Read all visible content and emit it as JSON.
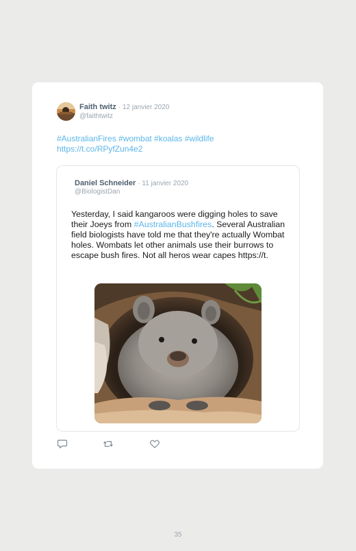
{
  "tweet": {
    "author_name": "Faith twitz",
    "date": "· 12 janvier 2020",
    "handle": "@faithtwitz",
    "hashtags": "#AustralianFires #wombat #koalas #wildlife",
    "link": "https://t.co/RPyfZun4e2"
  },
  "quoted": {
    "author_name": "Daniel Schneider",
    "date": "· 11 janvier 2020",
    "handle": "@BiologistDan",
    "text_before": "Yesterday, I said kangaroos were digging holes to save their Joeys from ",
    "text_link": "#AustralianBushfires",
    "text_after": ". Several Australian field biologists have told me that they're actually Wombat holes. Wombats let other animals use their burrows to escape bush fires. Not all heros wear capes https://t."
  },
  "actions": {
    "reply_icon": "reply-bubble-icon",
    "retweet_icon": "retweet-icon",
    "like_icon": "heart-icon"
  },
  "page_number": "35"
}
